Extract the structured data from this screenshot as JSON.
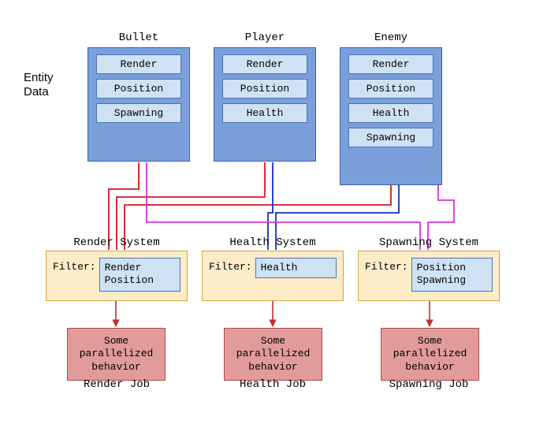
{
  "side_label_l1": "Entity",
  "side_label_l2": "Data",
  "entities": [
    {
      "title": "Bullet",
      "components": [
        "Render",
        "Position",
        "Spawning"
      ]
    },
    {
      "title": "Player",
      "components": [
        "Render",
        "Position",
        "Health"
      ]
    },
    {
      "title": "Enemy",
      "components": [
        "Render",
        "Position",
        "Health",
        "Spawning"
      ]
    }
  ],
  "systems": [
    {
      "title": "Render System",
      "filter_label": "Filter:",
      "filter_items": [
        "Render",
        "Position"
      ],
      "job_text": "Some\nparallelized\nbehavior",
      "job_title": "Render Job"
    },
    {
      "title": "Health System",
      "filter_label": "Filter:",
      "filter_items": [
        "Health"
      ],
      "job_text": "Some\nparallelized\nbehavior",
      "job_title": "Health Job"
    },
    {
      "title": "Spawning System",
      "filter_label": "Filter:",
      "filter_items": [
        "Position",
        "Spawning"
      ],
      "job_text": "Some\nparallelized\nbehavior",
      "job_title": "Spawning Job"
    }
  ],
  "colors": {
    "render_line": "#e01020",
    "health_line": "#1030c0",
    "spawn_line": "#e030e0",
    "arrow": "#c03030"
  }
}
